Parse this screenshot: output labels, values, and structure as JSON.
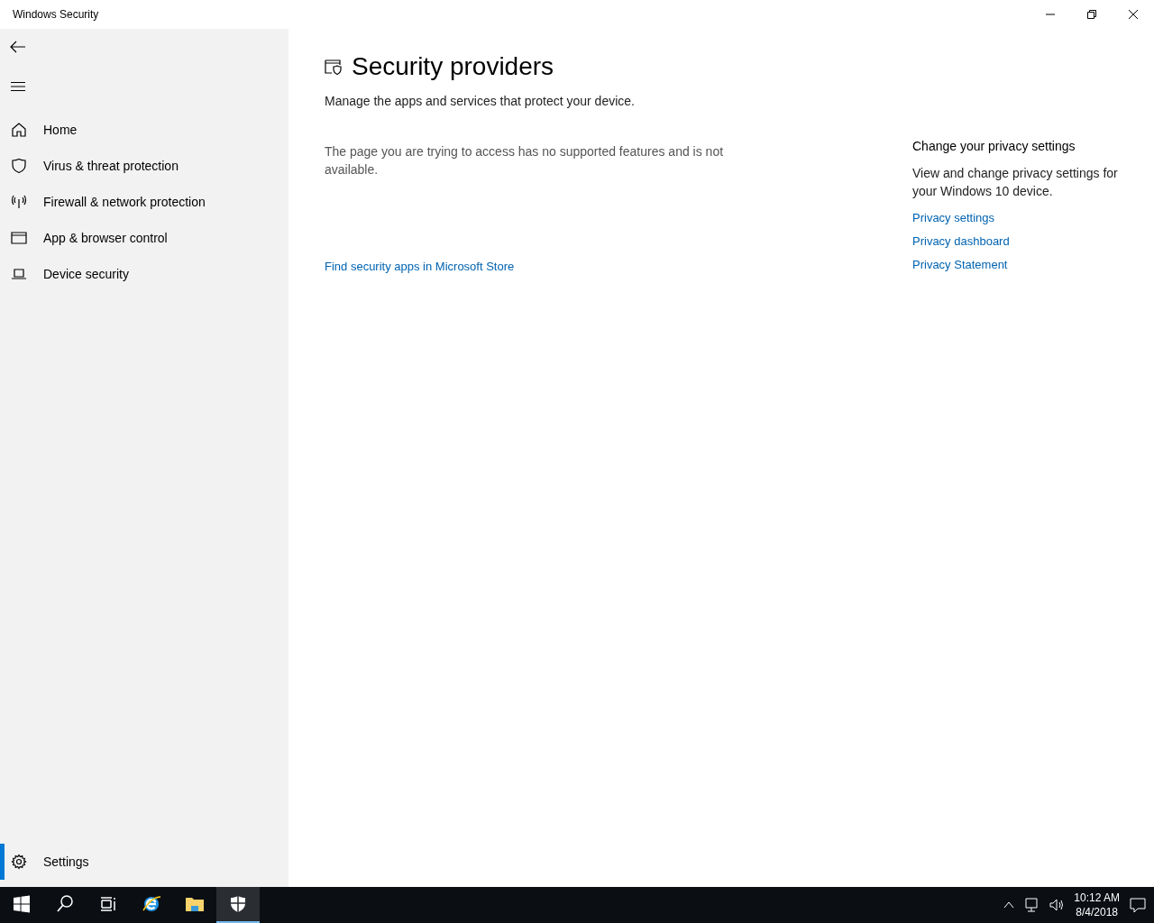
{
  "window": {
    "title": "Windows Security"
  },
  "sidebar": {
    "items": [
      {
        "kind": "home",
        "label": "Home",
        "selected": false
      },
      {
        "kind": "shield",
        "label": "Virus & threat protection",
        "selected": false
      },
      {
        "kind": "antenna",
        "label": "Firewall & network protection",
        "selected": false
      },
      {
        "kind": "browser",
        "label": "App & browser control",
        "selected": false
      },
      {
        "kind": "laptop",
        "label": "Device security",
        "selected": false
      }
    ],
    "footer": {
      "kind": "gear",
      "label": "Settings",
      "selected": true
    }
  },
  "page": {
    "title": "Security providers",
    "subtitle": "Manage the apps and services that protect your device.",
    "message": "The page you are trying to access has no supported features and is not available.",
    "link": "Find security apps in Microsoft Store"
  },
  "aside": {
    "title": "Change your privacy settings",
    "text": "View and change privacy settings for your Windows 10 device.",
    "links": [
      "Privacy settings",
      "Privacy dashboard",
      "Privacy Statement"
    ]
  },
  "taskbar": {
    "apps": [
      {
        "kind": "start",
        "active": false
      },
      {
        "kind": "search",
        "active": false
      },
      {
        "kind": "taskview",
        "active": false
      },
      {
        "kind": "ie",
        "active": false
      },
      {
        "kind": "folder",
        "active": false
      },
      {
        "kind": "security",
        "active": true
      }
    ],
    "time": "10:12 AM",
    "date": "8/4/2018"
  }
}
